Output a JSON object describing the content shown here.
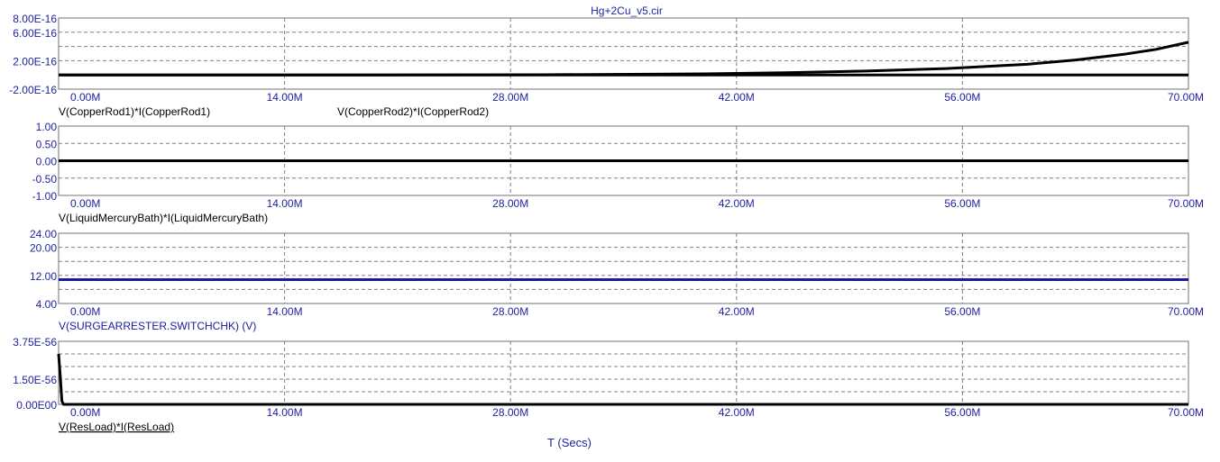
{
  "window": {
    "title": "Hg+2Cu_v5.cir"
  },
  "x_axis": {
    "title": "T (Secs)",
    "range": [
      0,
      70000000
    ],
    "ticks": [
      0,
      14000000,
      28000000,
      42000000,
      56000000,
      70000000
    ],
    "tick_labels": [
      "0.00M",
      "14.00M",
      "28.00M",
      "42.00M",
      "56.00M",
      "70.00M"
    ]
  },
  "colors": {
    "axis_text": "#1f1fa0",
    "trace_black": "#000000",
    "trace_blue": "#1a1a9c",
    "grid": "#808080"
  },
  "chart_data": [
    {
      "type": "line",
      "ylim": [
        -2e-16,
        8e-16
      ],
      "y_tick_labels": [
        {
          "value": 8e-16,
          "label": "8.00E-16"
        },
        {
          "value": 6e-16,
          "label": "6.00E-16"
        },
        {
          "value": 2e-16,
          "label": "2.00E-16"
        },
        {
          "value": -2e-16,
          "label": "-2.00E-16"
        }
      ],
      "series": [
        {
          "name": "V(CopperRod1)*I(CopperRod1)",
          "color": "#000000",
          "x": [
            0,
            10000000,
            20000000,
            30000000,
            40000000,
            45000000,
            50000000,
            55000000,
            60000000,
            63000000,
            66000000,
            68000000,
            70000000
          ],
          "y": [
            0,
            0,
            0,
            2e-18,
            1.5e-17,
            3e-17,
            5.5e-17,
            9e-17,
            1.5e-16,
            2.1e-16,
            2.9e-16,
            3.6e-16,
            4.6e-16
          ]
        },
        {
          "name": "V(CopperRod2)*I(CopperRod2)",
          "color": "#000000",
          "x": [
            0,
            70000000
          ],
          "y": [
            0,
            0
          ]
        }
      ]
    },
    {
      "type": "line",
      "ylim": [
        -1,
        1
      ],
      "y_tick_labels": [
        {
          "value": 1,
          "label": "1.00"
        },
        {
          "value": 0.5,
          "label": "0.50"
        },
        {
          "value": 0,
          "label": "0.00"
        },
        {
          "value": -0.5,
          "label": "-0.50"
        },
        {
          "value": -1,
          "label": "-1.00"
        }
      ],
      "series": [
        {
          "name": "V(LiquidMercuryBath)*I(LiquidMercuryBath)",
          "color": "#000000",
          "x": [
            0,
            70000000
          ],
          "y": [
            0,
            0
          ]
        }
      ]
    },
    {
      "type": "line",
      "ylim": [
        4,
        24
      ],
      "y_tick_labels": [
        {
          "value": 24,
          "label": "24.00"
        },
        {
          "value": 20,
          "label": "20.00"
        },
        {
          "value": 12,
          "label": "12.00"
        },
        {
          "value": 4,
          "label": "4.00"
        }
      ],
      "series": [
        {
          "name": "V(SURGEARRESTER.SWITCHCHK) (V)",
          "color": "#1a1a9c",
          "x": [
            0,
            70000000
          ],
          "y": [
            10.8,
            10.8
          ]
        }
      ]
    },
    {
      "type": "line",
      "ylim": [
        0,
        3.75e-56
      ],
      "y_tick_labels": [
        {
          "value": 3.75e-56,
          "label": "3.75E-56"
        },
        {
          "value": 1.5e-56,
          "label": "1.50E-56"
        },
        {
          "value": 0,
          "label": "0.00E00"
        }
      ],
      "series": [
        {
          "name": "V(ResLoad)*I(ResLoad)",
          "color": "#000000",
          "x": [
            0,
            100000,
            200000,
            300000,
            70000000
          ],
          "y": [
            3e-56,
            1.7e-56,
            2e-57,
            0,
            0
          ]
        }
      ]
    }
  ]
}
